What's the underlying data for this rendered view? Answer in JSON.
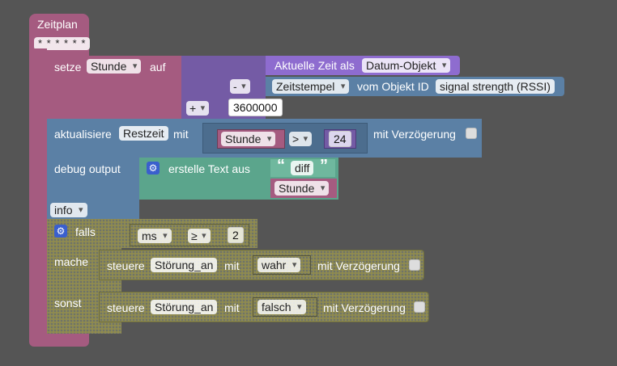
{
  "hat": {
    "title": "Zeitplan",
    "cron": "* * * * * *"
  },
  "set_block": {
    "prefix": "setze",
    "var": "Stunde",
    "suffix": "auf",
    "op_plus": "+",
    "op_minus": "-",
    "current_time_label": "Aktuelle Zeit als",
    "current_time_format": "Datum-Objekt",
    "timestamp_field": "Zeitstempel",
    "from_object": "vom Objekt ID",
    "object_id": "signal strength (RSSI)",
    "divisor": "3600000"
  },
  "update_block": {
    "label": "aktualisiere",
    "target": "Restzeit",
    "with": "mit",
    "compare_var": "Stunde",
    "compare_op": ">",
    "compare_val": "24",
    "delay_label": "mit Verzögerung"
  },
  "debug_block": {
    "label": "debug output",
    "text_label": "erstellle Text aus",
    "text_label_real": "erstelle Text aus",
    "quote_open": "“",
    "string_val": "diff",
    "quote_close": "”",
    "var": "Stunde",
    "level": "info"
  },
  "if_block": {
    "if_label": "falls",
    "cond_var": "ms",
    "cond_op": "≥",
    "cond_val": "2",
    "then_label": "mache",
    "else_label": "sonst",
    "then_cmd": "steuere",
    "then_target": "Störung_an",
    "then_with": "mit",
    "then_value": "wahr",
    "then_delay": "mit Verzögerung",
    "else_cmd": "steuere",
    "else_target": "Störung_an",
    "else_with": "mit",
    "else_value": "falsch",
    "else_delay": "mit Verzögerung"
  }
}
